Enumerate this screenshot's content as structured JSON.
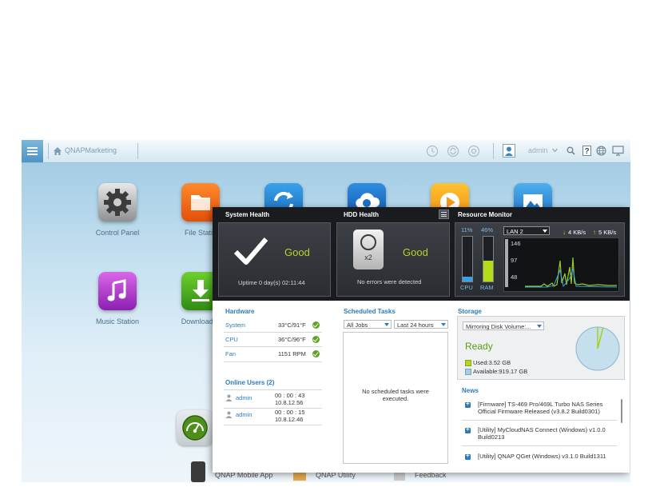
{
  "topbar": {
    "host": "QNAPMarketing",
    "user": "admin",
    "icons": [
      "menu-icon",
      "home-icon",
      "clock-icon",
      "sync-icon",
      "circle-icon",
      "user-avatar-icon",
      "chevron-down-icon",
      "search-icon",
      "help-icon",
      "globe-icon",
      "monitor-icon"
    ]
  },
  "desktop": {
    "apps": [
      {
        "label": "Control Panel",
        "icon": "gear-icon"
      },
      {
        "label": "File Statio",
        "icon": "folder-icon"
      },
      {
        "label": "",
        "icon": "sync-icon"
      },
      {
        "label": "",
        "icon": "cloud-icon"
      },
      {
        "label": "",
        "icon": "play-icon"
      },
      {
        "label": "",
        "icon": "photo-icon"
      },
      {
        "label": "Music Station",
        "icon": "music-icon"
      },
      {
        "label": "Download S",
        "icon": "download-icon"
      }
    ],
    "dock": [
      "QNAP Mobile App",
      "QNAP Utility",
      "Feedback"
    ]
  },
  "dashboard": {
    "system_health": {
      "title": "System Health",
      "status": "Good",
      "uptime": "Uptime 0 day(s) 02:11:44"
    },
    "hdd_health": {
      "title": "HDD Health",
      "status": "Good",
      "count": "x2",
      "message": "No errors were detected"
    },
    "resource_monitor": {
      "title": "Resource Monitor",
      "cpu_percent": "11%",
      "ram_percent": "46%",
      "cpu_label": "CPU",
      "ram_label": "RAM",
      "cpu_fraction": 0.11,
      "ram_fraction": 0.46,
      "lan_select": "LAN 2",
      "down_rate": "4 KB/s",
      "up_rate": "5 KB/s",
      "ticks": [
        "146",
        "97",
        "48"
      ]
    },
    "hardware": {
      "title": "Hardware",
      "rows": [
        {
          "name": "System",
          "value": "33°C/91°F"
        },
        {
          "name": "CPU",
          "value": "36°C/96°F"
        },
        {
          "name": "Fan",
          "value": "1151 RPM"
        }
      ]
    },
    "online_users": {
      "title": "Online Users (2)",
      "users": [
        {
          "name": "admin",
          "time": "00 : 00 : 43",
          "ip": "10.8.12.56"
        },
        {
          "name": "admin",
          "time": "00 : 00 : 15",
          "ip": "10.8.12.46"
        }
      ]
    },
    "scheduled_tasks": {
      "title": "Scheduled Tasks",
      "filter_jobs": "All Jobs",
      "filter_time": "Last 24 hours",
      "empty_line1": "No scheduled tasks were",
      "empty_line2": "executed."
    },
    "storage": {
      "title": "Storage",
      "volume_select": "Mirroring Disk Volume:...",
      "status": "Ready",
      "used": "Used:3.52 GB",
      "available": "Available:919.17 GB",
      "used_fraction": 0.004
    },
    "news": {
      "title": "News",
      "items": [
        {
          "line1": "[Firmware] TS-469 Pro/469L Turbo NAS Series",
          "line2": "Official Firmware Released (v3.8.2 Build0301)"
        },
        {
          "line1": "[Utility] MyCloudNAS Connect (Windows) v1.0.0",
          "line2": "Build0213"
        },
        {
          "line1": "[Utility] QNAP QGet (Windows) v3.1.0 Build1311",
          "line2": ""
        }
      ]
    }
  }
}
